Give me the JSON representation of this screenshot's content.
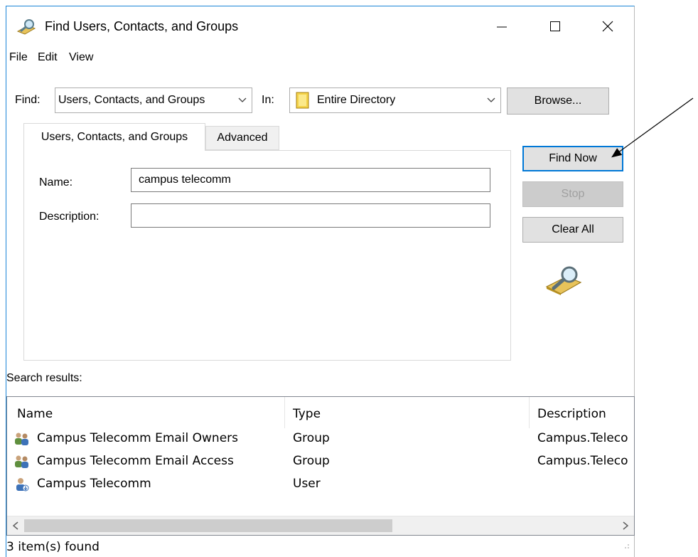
{
  "window": {
    "title": "Find Users, Contacts, and Groups"
  },
  "menu": [
    "File",
    "Edit",
    "View"
  ],
  "find": {
    "find_label": "Find:",
    "find_value": "Users, Contacts, and Groups",
    "in_label": "In:",
    "in_value": "Entire Directory",
    "browse_label": "Browse..."
  },
  "tabs": [
    {
      "label": "Users, Contacts, and Groups",
      "active": true
    },
    {
      "label": "Advanced",
      "active": false
    }
  ],
  "form": {
    "name_label": "Name:",
    "name_value": "campus telecomm",
    "description_label": "Description:",
    "description_value": ""
  },
  "buttons": {
    "find_now": "Find Now",
    "stop": "Stop",
    "clear_all": "Clear All"
  },
  "results": {
    "label": "Search results:",
    "columns": [
      "Name",
      "Type",
      "Description"
    ],
    "rows": [
      {
        "name": "Campus Telecomm Email Owners",
        "type": "Group",
        "description": "Campus.Teleco",
        "icon": "group-icon"
      },
      {
        "name": "Campus Telecomm Email Access",
        "type": "Group",
        "description": "Campus.Teleco",
        "icon": "group-icon"
      },
      {
        "name": "Campus Telecomm",
        "type": "User",
        "description": "",
        "icon": "user-icon"
      }
    ]
  },
  "status": "3 item(s) found",
  "colors": {
    "accent": "#0078d7",
    "title_border": "#1883d7"
  }
}
